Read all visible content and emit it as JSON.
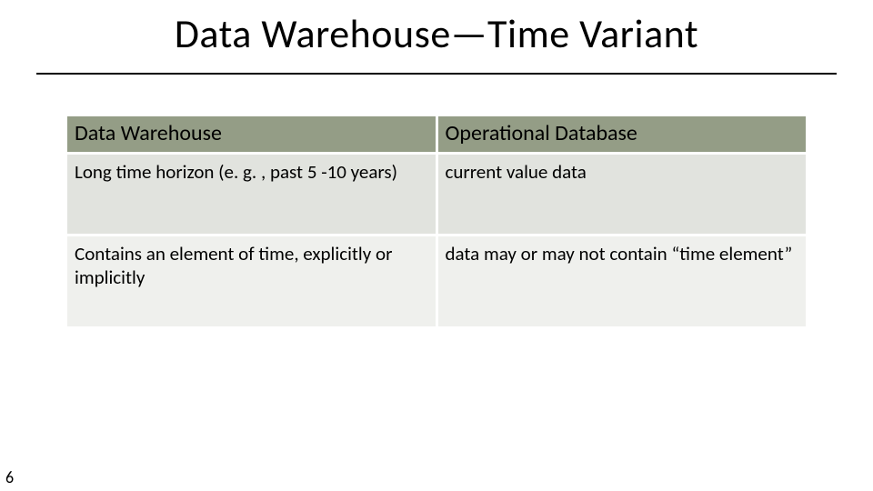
{
  "title": "Data Warehouse—Time Variant",
  "table": {
    "headers": [
      "Data Warehouse",
      "Operational Database"
    ],
    "rows": [
      [
        "Long time horizon (e. g. , past 5 -10 years)",
        " current value data"
      ],
      [
        "Contains an element of time, explicitly or implicitly",
        "data may or may not contain “time element”"
      ]
    ]
  },
  "page_number": "6"
}
